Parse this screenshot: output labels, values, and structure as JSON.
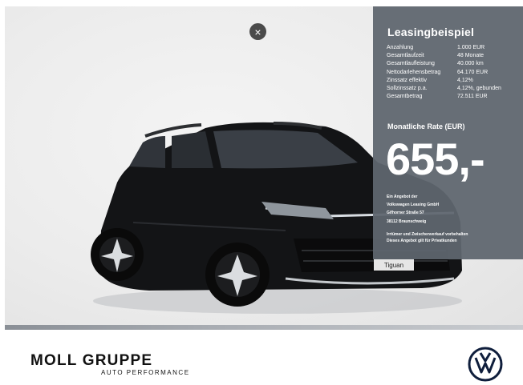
{
  "ui": {
    "close_icon": "close-icon",
    "close_glyph": "×"
  },
  "leasing": {
    "title": "Leasingbeispiel",
    "rows": [
      {
        "label": "Anzahlung",
        "value": "1.000 EUR"
      },
      {
        "label": "Gesamtlaufzeit",
        "value": "48 Monate"
      },
      {
        "label": "Gesamtlaufleistung",
        "value": "40.000 km"
      },
      {
        "label": "Nettodarlehensbetrag",
        "value": "64.170 EUR"
      },
      {
        "label": "Zinssatz effektiv",
        "value": "4,12%"
      },
      {
        "label": "Sollzinssatz p.a.",
        "value": "4,12%, gebunden"
      },
      {
        "label": "Gesamtbetrag",
        "value": "72.511 EUR"
      }
    ],
    "rate_label": "Monatliche Rate (EUR)",
    "rate_value": "655,-",
    "provider_lines": [
      "Ein Angebot der",
      "Volkswagen Leasing GmbH",
      "Gifhorner Straße 57",
      "38112 Braunschweig"
    ],
    "disclaimer_lines": [
      "Irrtümer und Zwischenverkauf vorbehalten",
      "Dieses Angebot gilt für Privatkunden"
    ]
  },
  "car": {
    "plate_text": "Tiguan",
    "body_color": "#111214"
  },
  "footer": {
    "brand": "MOLL GRUPPE",
    "brand_sub": "AUTO PERFORMANCE",
    "logo_icon": "vw-logo-icon"
  },
  "colors": {
    "panel": "#5f666e",
    "text_light": "#ffffff"
  }
}
